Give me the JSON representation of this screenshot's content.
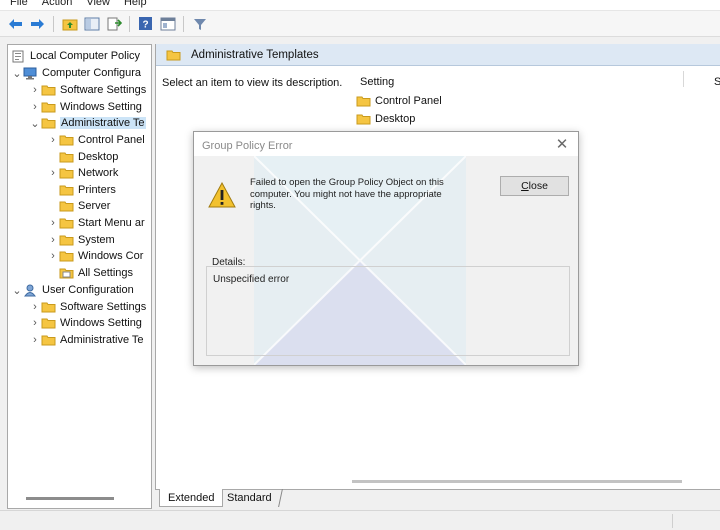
{
  "menu": [
    "File",
    "Action",
    "View",
    "Help"
  ],
  "toolbar": {
    "icons": [
      "back-arrow-icon",
      "forward-arrow-icon",
      "up-folder-icon",
      "show-hide-tree-icon",
      "export-list-icon",
      "help-icon",
      "properties-pane-icon",
      "filter-icon"
    ]
  },
  "tree": {
    "root": "Local Computer Policy",
    "computer_config": "Computer Configura",
    "computer_children": {
      "software": "Software Settings",
      "windows": "Windows Setting",
      "admin": "Administrative Te"
    },
    "admin_children": [
      "Control Panel",
      "Desktop",
      "Network",
      "Printers",
      "Server",
      "Start Menu ar",
      "System",
      "Windows Cor",
      "All Settings"
    ],
    "user_config": "User Configuration",
    "user_children": {
      "software": "Software Settings",
      "windows": "Windows Setting",
      "admin": "Administrative Te"
    }
  },
  "right": {
    "header_title": "Administrative Templates",
    "description": "Select an item to view its description.",
    "column_setting": "Setting",
    "column_s": "S",
    "items": [
      "Control Panel",
      "Desktop"
    ]
  },
  "tabs": {
    "extended": "Extended",
    "standard": "Standard"
  },
  "dialog": {
    "title": "Group Policy Error",
    "close_glyph": "✕",
    "message": "Failed to open the Group Policy Object on this computer.  You might not have the appropriate rights.",
    "button_prefix": "",
    "button_accel": "C",
    "button_rest": "lose",
    "details_label": "Details:",
    "details_text": "Unspecified error"
  },
  "colors": {
    "header_bg": "#dde8f4",
    "selection_bg": "#cce4f7",
    "folder_yellow": "#f5c542",
    "warning_yellow": "#f2c12e"
  }
}
